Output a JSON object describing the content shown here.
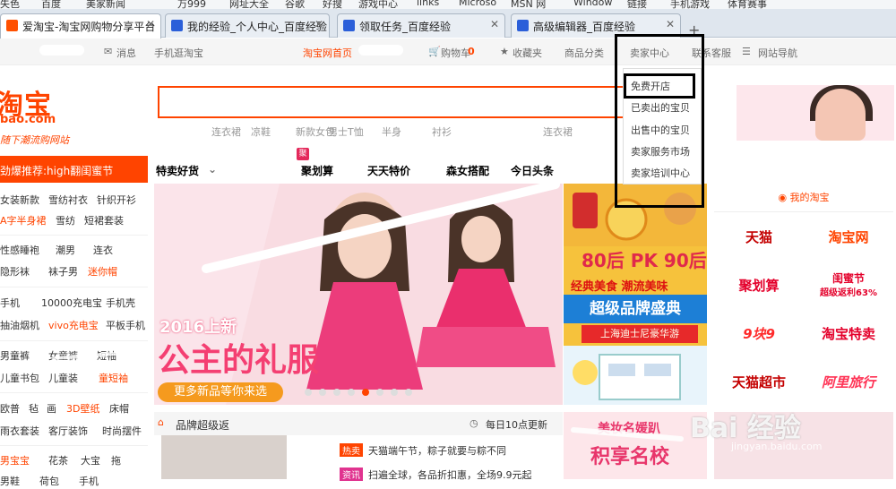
{
  "bookmarks": [
    "失色",
    "百度",
    "美家新闻",
    "万999",
    "网址大全",
    "谷歌",
    "好搜",
    "游戏中心",
    "links",
    "Microso",
    "MSN 网",
    "Window",
    "链接",
    "手机游戏",
    "体育赛事"
  ],
  "tabs": [
    {
      "title": "爱淘宝-淘宝网购物分享平台",
      "active": true
    },
    {
      "title": "我的经验_个人中心_百度经验",
      "active": false
    },
    {
      "title": "领取任务_百度经验",
      "active": false
    },
    {
      "title": "高级编辑器_百度经验",
      "active": false
    }
  ],
  "sitenav": {
    "message": "消息",
    "mobile": "手机逛淘宝",
    "home": "淘宝网首页",
    "cart_label": "购物车",
    "cart_count": "0",
    "fav": "收藏夹",
    "category": "商品分类",
    "seller": "卖家中心",
    "service": "联系客服",
    "sitemap": "网站导航"
  },
  "logo": {
    "main": "淘宝",
    "url": "bao.com",
    "slogan": "随下潮流购网站"
  },
  "hotwords": [
    "连衣裙",
    "凉鞋",
    "新款女包",
    "男士T恤",
    "半身",
    "衬衫",
    "连衣裙"
  ],
  "categories": [
    "特卖好货",
    "聚划算",
    "天天特价",
    "森女搭配",
    "今日头条"
  ],
  "ju_badge": "聚",
  "left": {
    "header": "劲爆推荐:high翻闺蜜节",
    "rows": [
      [
        "女装新款",
        "雪纺衬衣",
        "针织开衫"
      ],
      [
        "A字半身裙",
        "雪纺",
        "短裙套装"
      ],
      [
        "性感睡袍",
        "潮男",
        "连衣"
      ],
      [
        "隐形袜",
        "袜子男",
        "迷你帽"
      ],
      [
        "手机",
        "10000充电宝",
        "手机壳"
      ],
      [
        "抽油烟机",
        "vivo充电宝",
        "平板手机"
      ],
      [
        "男童裤",
        "女童裤",
        "短袖"
      ],
      [
        "儿童书包",
        "儿童装",
        "童短袖"
      ],
      [
        "欧普",
        "毡",
        "画",
        "3D壁纸",
        "床帽"
      ],
      [
        "雨衣套装",
        "客厅装饰",
        "时尚摆件"
      ],
      [
        "男宝宝",
        "花茶",
        "大宝",
        "拖"
      ],
      [
        "男鞋",
        "荷包",
        "手机"
      ]
    ]
  },
  "banner": {
    "line1": "2016上新",
    "line2": "公主的礼服",
    "button": "更多新品等你来选",
    "dots": 8,
    "active_dot": 5
  },
  "midad": {
    "t1": "80后 PK 90后",
    "t2": "经典美食 潮流美味",
    "t3": "超级品牌盛典",
    "t4": "上海迪士尼豪华游",
    "t5": "美妆名媛趴",
    "t6": "积享名校"
  },
  "mytb": {
    "header": "我的淘宝",
    "items": [
      "天猫",
      "淘宝网",
      "聚划算",
      "闺蜜节",
      "超级返利63%",
      "9块9",
      "淘宝特卖",
      "天猫超市",
      "阿里旅行"
    ]
  },
  "brand": {
    "title": "品牌超级返",
    "time": "每日10点更新"
  },
  "news": [
    {
      "tag": "热卖",
      "text": "天猫端午节，粽子就要与粽不同"
    },
    {
      "tag": "资讯",
      "text": "扫遍全球，各品折扣惠，全场9.9元起"
    }
  ],
  "dropdown": {
    "items": [
      "免费开店",
      "已卖出的宝贝",
      "出售中的宝贝",
      "卖家服务市场",
      "卖家培训中心"
    ]
  },
  "watermark": {
    "main": "Bai 经验",
    "sub": "jingyan.baidu.com"
  }
}
